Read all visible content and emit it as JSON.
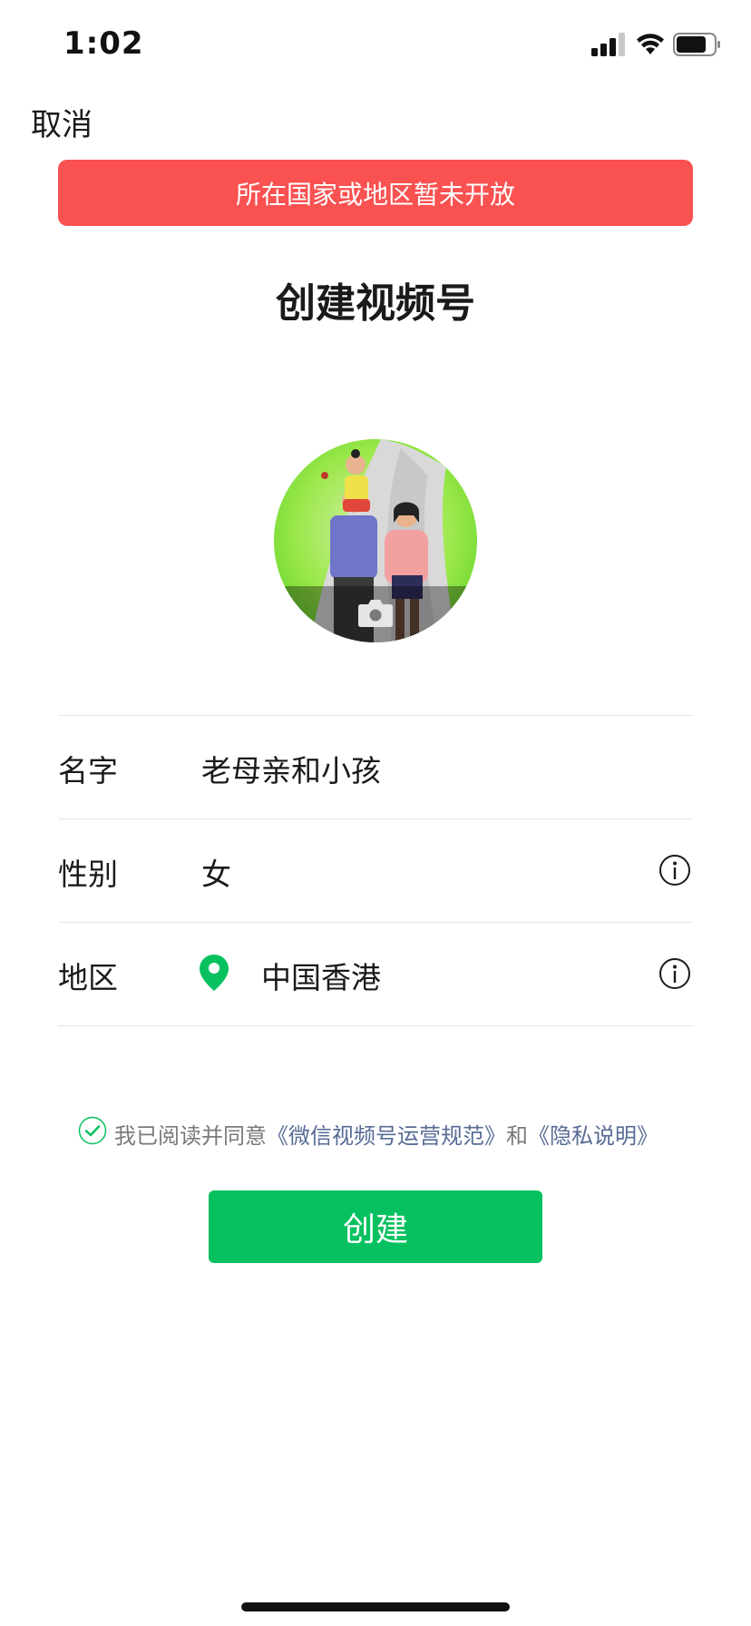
{
  "status_bar": {
    "time": "1:02"
  },
  "nav": {
    "cancel_label": "取消"
  },
  "banner": {
    "text": "所在国家或地区暂未开放",
    "color": "#fa5151"
  },
  "title": "创建视频号",
  "avatar": {
    "icon": "camera-icon"
  },
  "form": {
    "name": {
      "label": "名字",
      "value": "老母亲和小孩"
    },
    "gender": {
      "label": "性别",
      "value": "女"
    },
    "region": {
      "label": "地区",
      "value": "中国香港",
      "icon": "location-pin-icon"
    }
  },
  "agreement": {
    "checked": true,
    "prefix": "我已阅读并同意",
    "link1": "《微信视频号运营规范》",
    "conjunction": "和",
    "link2": "《隐私说明》"
  },
  "create_button": {
    "label": "创建",
    "color": "#07c160"
  }
}
